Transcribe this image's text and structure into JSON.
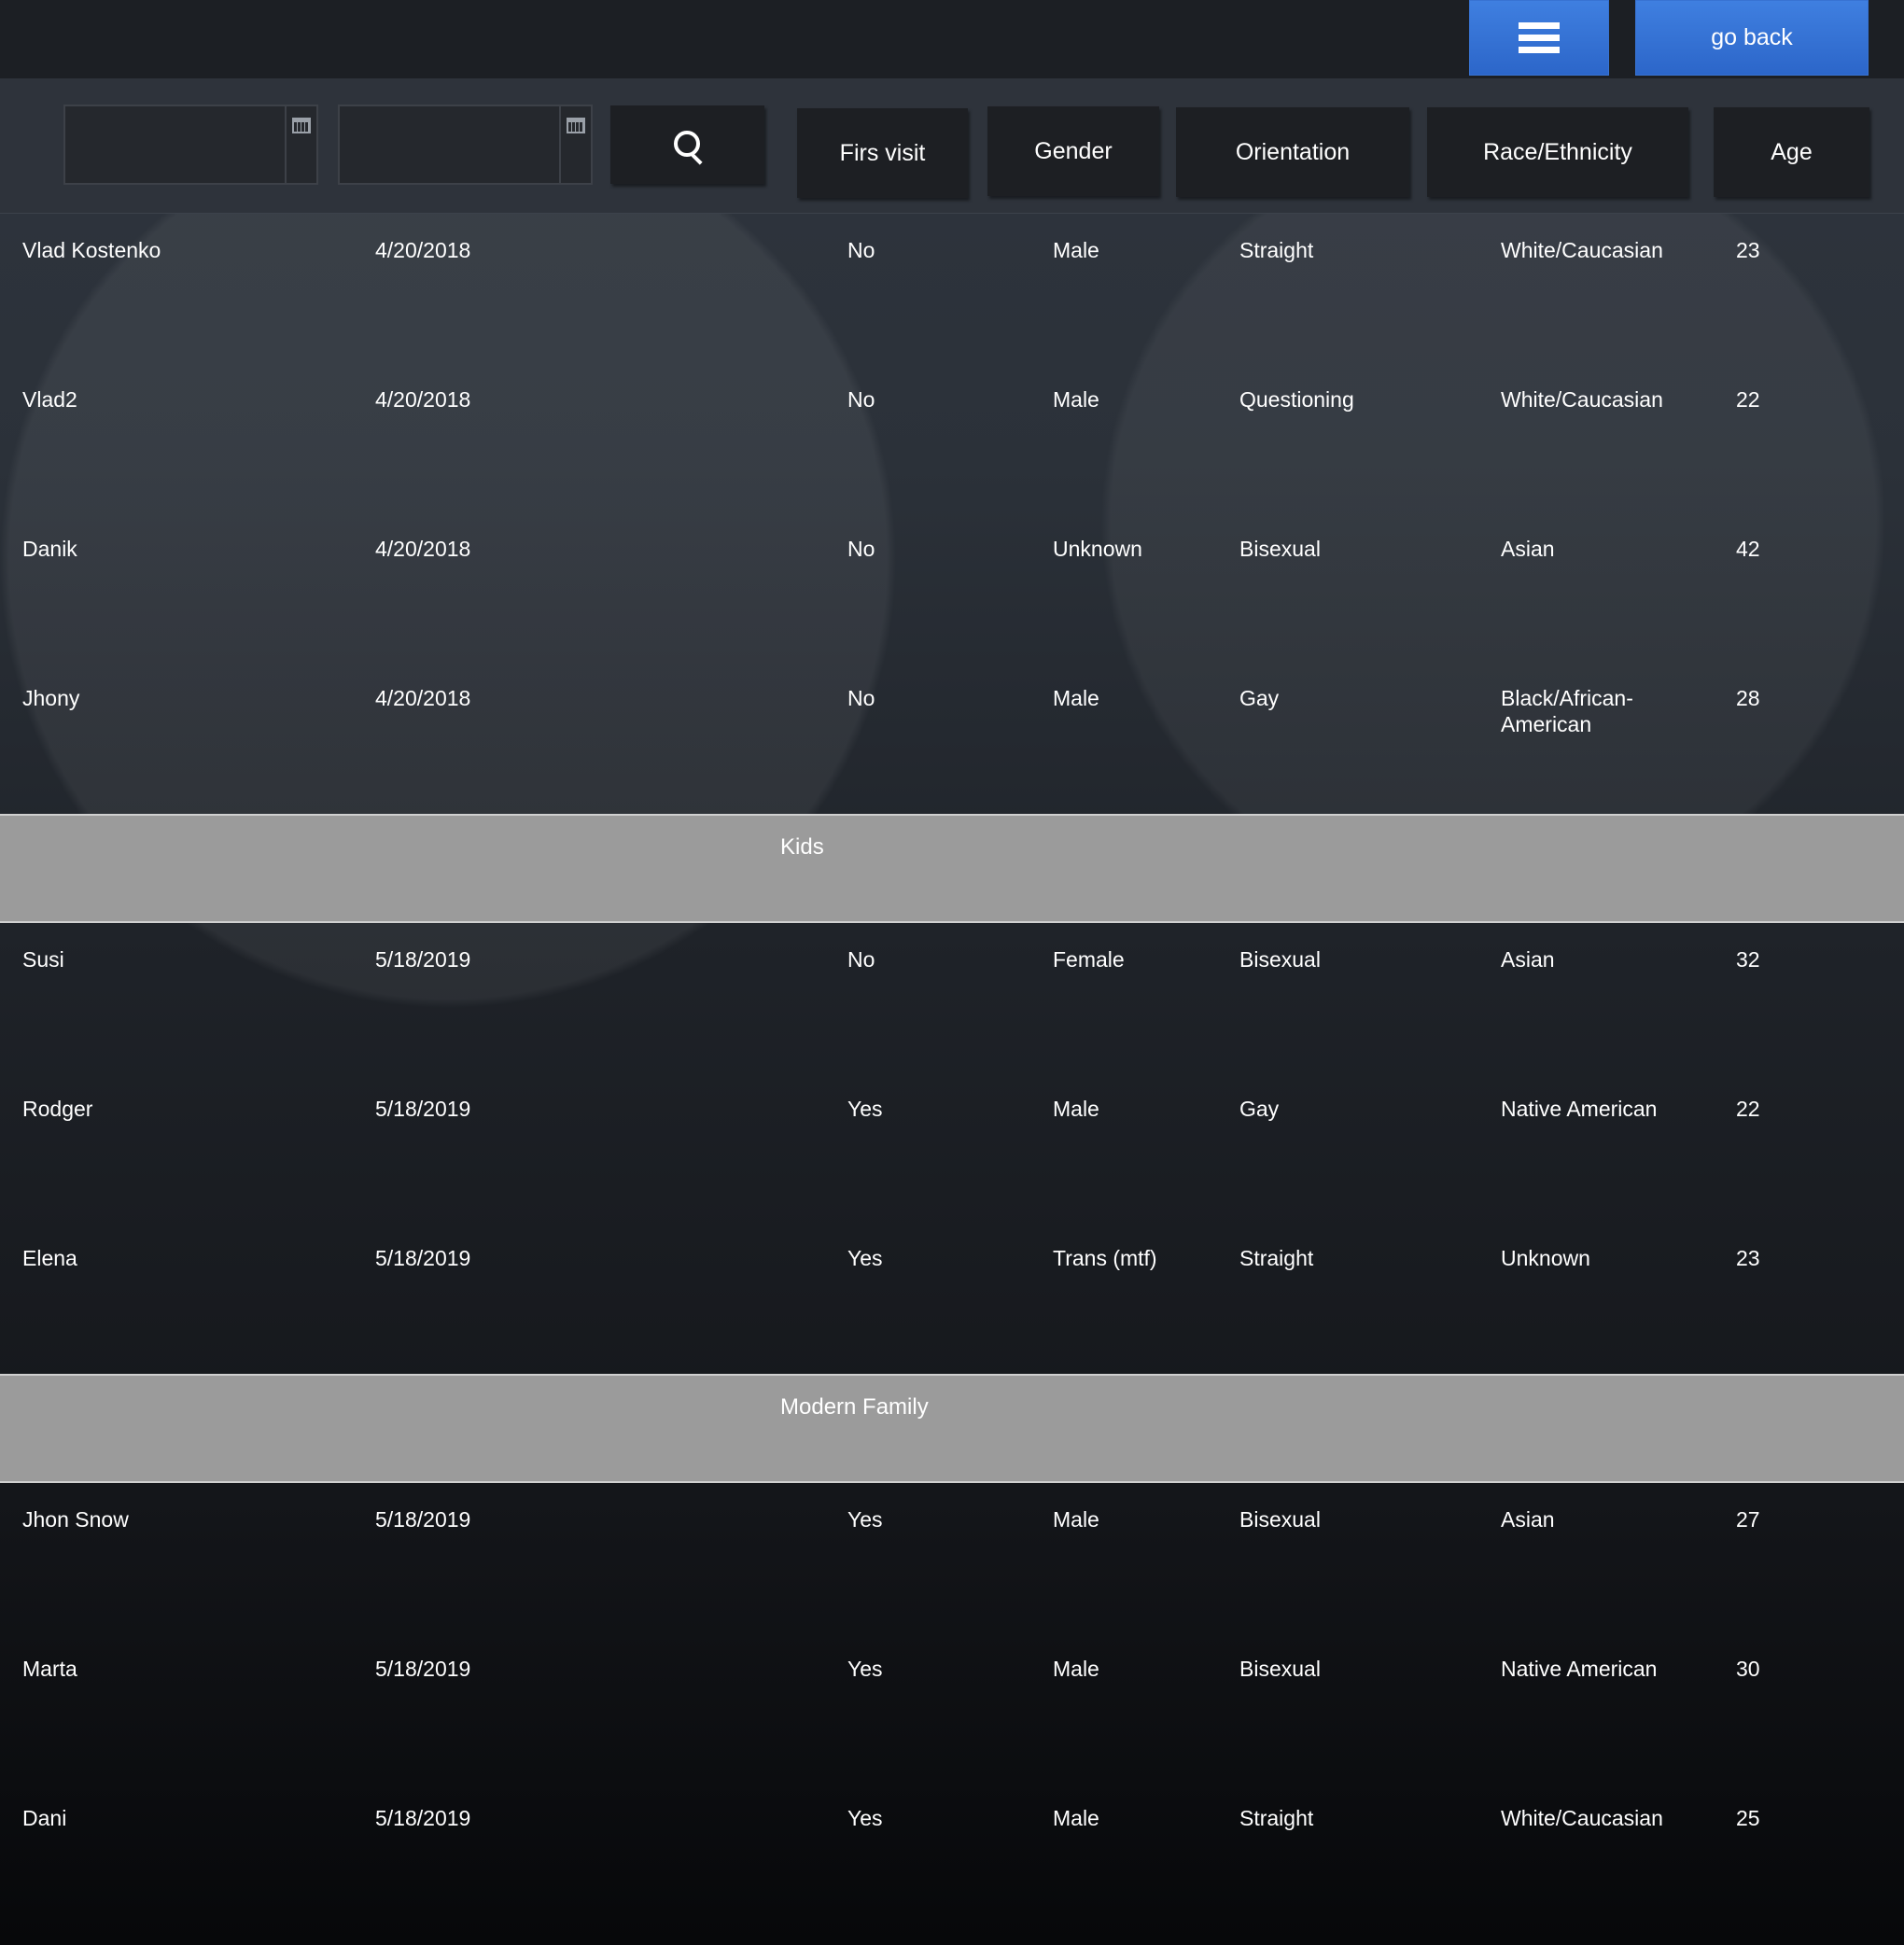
{
  "topbar": {
    "menu_icon": "hamburger-icon",
    "go_back_label": "go back"
  },
  "filters": {
    "date_from": {
      "value": "",
      "icon": "calendar-icon"
    },
    "date_to": {
      "value": "",
      "icon": "calendar-icon"
    },
    "search_icon": "search-icon"
  },
  "columns": {
    "first_visit": "Firs visit",
    "gender": "Gender",
    "orientation": "Orientation",
    "race": "Race/Ethnicity",
    "age": "Age"
  },
  "groups": [
    {
      "title": "",
      "rows": [
        {
          "name": "Vlad Kostenko",
          "date": "4/20/2018",
          "first_visit": "No",
          "gender": "Male",
          "orientation": "Straight",
          "race": "White/Caucasian",
          "age": "23"
        },
        {
          "name": "Vlad2",
          "date": "4/20/2018",
          "first_visit": "No",
          "gender": "Male",
          "orientation": "Questioning",
          "race": "White/Caucasian",
          "age": "22"
        },
        {
          "name": "Danik",
          "date": "4/20/2018",
          "first_visit": "No",
          "gender": "Unknown",
          "orientation": "Bisexual",
          "race": "Asian",
          "age": "42"
        },
        {
          "name": "Jhony",
          "date": "4/20/2018",
          "first_visit": "No",
          "gender": "Male",
          "orientation": "Gay",
          "race": "Black/African-American",
          "age": "28"
        }
      ]
    },
    {
      "title": "Kids",
      "rows": [
        {
          "name": "Susi",
          "date": "5/18/2019",
          "first_visit": "No",
          "gender": "Female",
          "orientation": "Bisexual",
          "race": "Asian",
          "age": "32"
        },
        {
          "name": "Rodger",
          "date": "5/18/2019",
          "first_visit": "Yes",
          "gender": "Male",
          "orientation": "Gay",
          "race": "Native American",
          "age": "22"
        },
        {
          "name": "Elena",
          "date": "5/18/2019",
          "first_visit": "Yes",
          "gender": "Trans (mtf)",
          "orientation": "Straight",
          "race": "Unknown",
          "age": "23"
        }
      ]
    },
    {
      "title": "Modern Family",
      "rows": [
        {
          "name": "Jhon Snow",
          "date": "5/18/2019",
          "first_visit": "Yes",
          "gender": "Male",
          "orientation": "Bisexual",
          "race": "Asian",
          "age": "27"
        },
        {
          "name": "Marta",
          "date": "5/18/2019",
          "first_visit": "Yes",
          "gender": "Male",
          "orientation": "Bisexual",
          "race": "Native American",
          "age": "30"
        },
        {
          "name": "Dani",
          "date": "5/18/2019",
          "first_visit": "Yes",
          "gender": "Male",
          "orientation": "Straight",
          "race": "White/Caucasian",
          "age": "25"
        }
      ]
    }
  ]
}
